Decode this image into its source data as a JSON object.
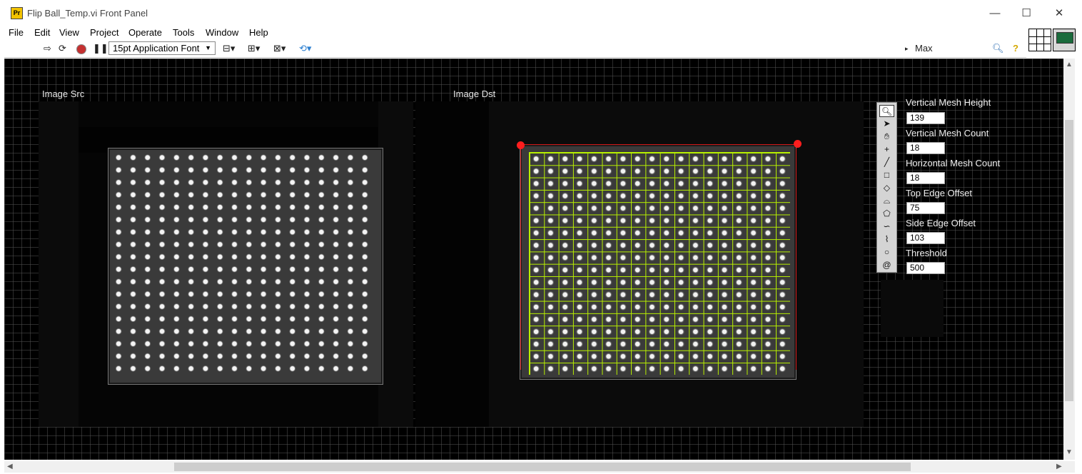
{
  "window": {
    "title": "Flip Ball_Temp.vi Front Panel",
    "app_icon": "Pr",
    "controls": {
      "minimize": "—",
      "maximize": "☐",
      "close": "✕"
    }
  },
  "menu": [
    "File",
    "Edit",
    "View",
    "Project",
    "Operate",
    "Tools",
    "Window",
    "Help"
  ],
  "toolbar": {
    "font": "15pt Application Font",
    "search": "Max",
    "icons": [
      "run-arrow-icon",
      "run-continuously-icon",
      "abort-icon",
      "pause-icon",
      "align-objects-icon",
      "distribute-objects-icon",
      "resize-objects-icon",
      "reorder-icon",
      "search-icon",
      "help-icon"
    ]
  },
  "panel": {
    "image_src_label": "Image Src",
    "image_dst_label": "Image Dst",
    "roi_tools": [
      "zoom-icon",
      "selection-arrow-icon",
      "pan-hand-icon",
      "point-icon",
      "line-icon",
      "rectangle-icon",
      "rotated-rect-icon",
      "annulus-icon",
      "polygon-icon",
      "freehand-icon",
      "broken-line-icon",
      "oval-icon",
      "spiral-icon"
    ],
    "controls": [
      {
        "label": "Vertical Mesh Height",
        "value": "139"
      },
      {
        "label": "Vertical Mesh Count",
        "value": "18"
      },
      {
        "label": "Horizontal Mesh Count",
        "value": "18"
      },
      {
        "label": "Top Edge Offset",
        "value": "75"
      },
      {
        "label": "Side Edge Offset",
        "value": "103"
      },
      {
        "label": "Threshold",
        "value": "500"
      }
    ],
    "colors": {
      "mesh": "#b8f000",
      "marker": "#ff1e1e",
      "background": "#000000"
    }
  }
}
